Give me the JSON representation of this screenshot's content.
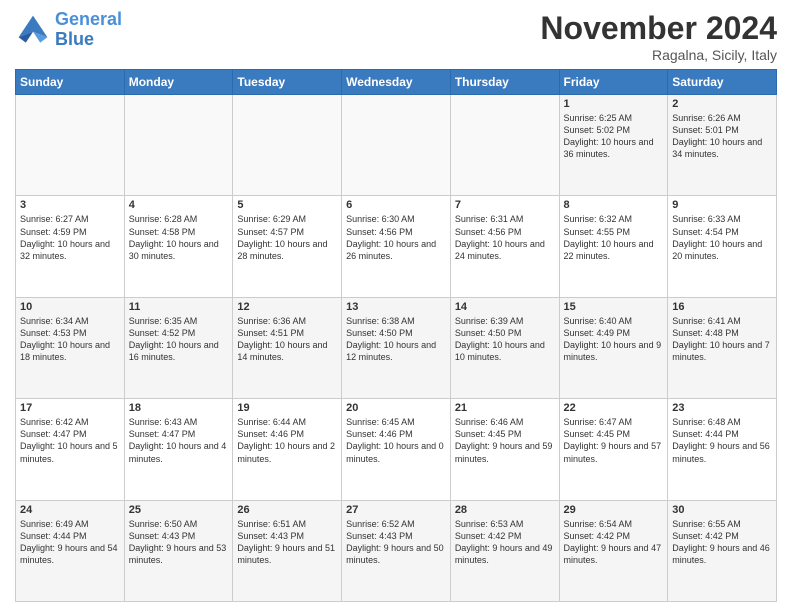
{
  "header": {
    "logo_line1": "General",
    "logo_line2": "Blue",
    "month": "November 2024",
    "location": "Ragalna, Sicily, Italy"
  },
  "weekdays": [
    "Sunday",
    "Monday",
    "Tuesday",
    "Wednesday",
    "Thursday",
    "Friday",
    "Saturday"
  ],
  "weeks": [
    [
      {
        "day": "",
        "info": ""
      },
      {
        "day": "",
        "info": ""
      },
      {
        "day": "",
        "info": ""
      },
      {
        "day": "",
        "info": ""
      },
      {
        "day": "",
        "info": ""
      },
      {
        "day": "1",
        "info": "Sunrise: 6:25 AM\nSunset: 5:02 PM\nDaylight: 10 hours and 36 minutes."
      },
      {
        "day": "2",
        "info": "Sunrise: 6:26 AM\nSunset: 5:01 PM\nDaylight: 10 hours and 34 minutes."
      }
    ],
    [
      {
        "day": "3",
        "info": "Sunrise: 6:27 AM\nSunset: 4:59 PM\nDaylight: 10 hours and 32 minutes."
      },
      {
        "day": "4",
        "info": "Sunrise: 6:28 AM\nSunset: 4:58 PM\nDaylight: 10 hours and 30 minutes."
      },
      {
        "day": "5",
        "info": "Sunrise: 6:29 AM\nSunset: 4:57 PM\nDaylight: 10 hours and 28 minutes."
      },
      {
        "day": "6",
        "info": "Sunrise: 6:30 AM\nSunset: 4:56 PM\nDaylight: 10 hours and 26 minutes."
      },
      {
        "day": "7",
        "info": "Sunrise: 6:31 AM\nSunset: 4:56 PM\nDaylight: 10 hours and 24 minutes."
      },
      {
        "day": "8",
        "info": "Sunrise: 6:32 AM\nSunset: 4:55 PM\nDaylight: 10 hours and 22 minutes."
      },
      {
        "day": "9",
        "info": "Sunrise: 6:33 AM\nSunset: 4:54 PM\nDaylight: 10 hours and 20 minutes."
      }
    ],
    [
      {
        "day": "10",
        "info": "Sunrise: 6:34 AM\nSunset: 4:53 PM\nDaylight: 10 hours and 18 minutes."
      },
      {
        "day": "11",
        "info": "Sunrise: 6:35 AM\nSunset: 4:52 PM\nDaylight: 10 hours and 16 minutes."
      },
      {
        "day": "12",
        "info": "Sunrise: 6:36 AM\nSunset: 4:51 PM\nDaylight: 10 hours and 14 minutes."
      },
      {
        "day": "13",
        "info": "Sunrise: 6:38 AM\nSunset: 4:50 PM\nDaylight: 10 hours and 12 minutes."
      },
      {
        "day": "14",
        "info": "Sunrise: 6:39 AM\nSunset: 4:50 PM\nDaylight: 10 hours and 10 minutes."
      },
      {
        "day": "15",
        "info": "Sunrise: 6:40 AM\nSunset: 4:49 PM\nDaylight: 10 hours and 9 minutes."
      },
      {
        "day": "16",
        "info": "Sunrise: 6:41 AM\nSunset: 4:48 PM\nDaylight: 10 hours and 7 minutes."
      }
    ],
    [
      {
        "day": "17",
        "info": "Sunrise: 6:42 AM\nSunset: 4:47 PM\nDaylight: 10 hours and 5 minutes."
      },
      {
        "day": "18",
        "info": "Sunrise: 6:43 AM\nSunset: 4:47 PM\nDaylight: 10 hours and 4 minutes."
      },
      {
        "day": "19",
        "info": "Sunrise: 6:44 AM\nSunset: 4:46 PM\nDaylight: 10 hours and 2 minutes."
      },
      {
        "day": "20",
        "info": "Sunrise: 6:45 AM\nSunset: 4:46 PM\nDaylight: 10 hours and 0 minutes."
      },
      {
        "day": "21",
        "info": "Sunrise: 6:46 AM\nSunset: 4:45 PM\nDaylight: 9 hours and 59 minutes."
      },
      {
        "day": "22",
        "info": "Sunrise: 6:47 AM\nSunset: 4:45 PM\nDaylight: 9 hours and 57 minutes."
      },
      {
        "day": "23",
        "info": "Sunrise: 6:48 AM\nSunset: 4:44 PM\nDaylight: 9 hours and 56 minutes."
      }
    ],
    [
      {
        "day": "24",
        "info": "Sunrise: 6:49 AM\nSunset: 4:44 PM\nDaylight: 9 hours and 54 minutes."
      },
      {
        "day": "25",
        "info": "Sunrise: 6:50 AM\nSunset: 4:43 PM\nDaylight: 9 hours and 53 minutes."
      },
      {
        "day": "26",
        "info": "Sunrise: 6:51 AM\nSunset: 4:43 PM\nDaylight: 9 hours and 51 minutes."
      },
      {
        "day": "27",
        "info": "Sunrise: 6:52 AM\nSunset: 4:43 PM\nDaylight: 9 hours and 50 minutes."
      },
      {
        "day": "28",
        "info": "Sunrise: 6:53 AM\nSunset: 4:42 PM\nDaylight: 9 hours and 49 minutes."
      },
      {
        "day": "29",
        "info": "Sunrise: 6:54 AM\nSunset: 4:42 PM\nDaylight: 9 hours and 47 minutes."
      },
      {
        "day": "30",
        "info": "Sunrise: 6:55 AM\nSunset: 4:42 PM\nDaylight: 9 hours and 46 minutes."
      }
    ]
  ]
}
